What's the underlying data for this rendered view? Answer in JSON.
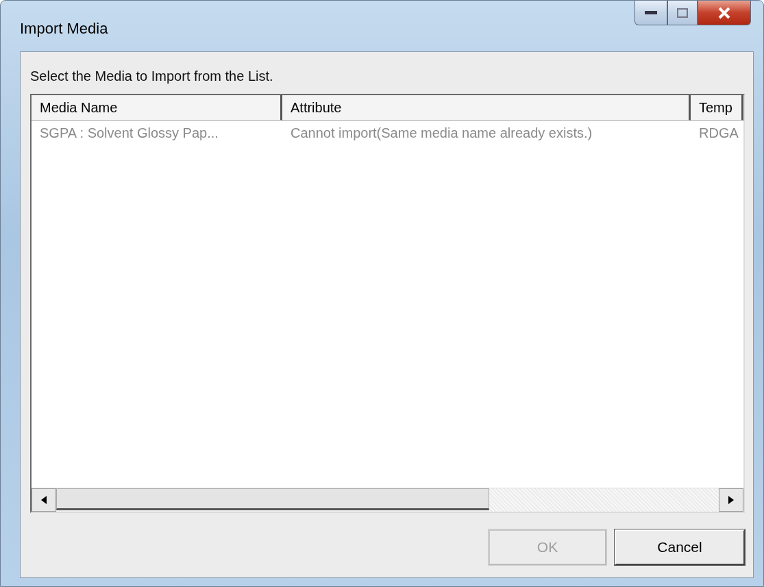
{
  "window": {
    "title": "Import Media"
  },
  "instruction": "Select the Media to Import from the List.",
  "table": {
    "columns": [
      "Media Name",
      "Attribute",
      "Temp"
    ],
    "rows": [
      {
        "cells": [
          "SGPA : Solvent Glossy Pap...",
          "Cannot import(Same media name already exists.)",
          "RDGA"
        ],
        "disabled": true
      }
    ]
  },
  "buttons": [
    {
      "label": "OK",
      "disabled": true
    },
    {
      "label": "Cancel",
      "disabled": false
    }
  ]
}
